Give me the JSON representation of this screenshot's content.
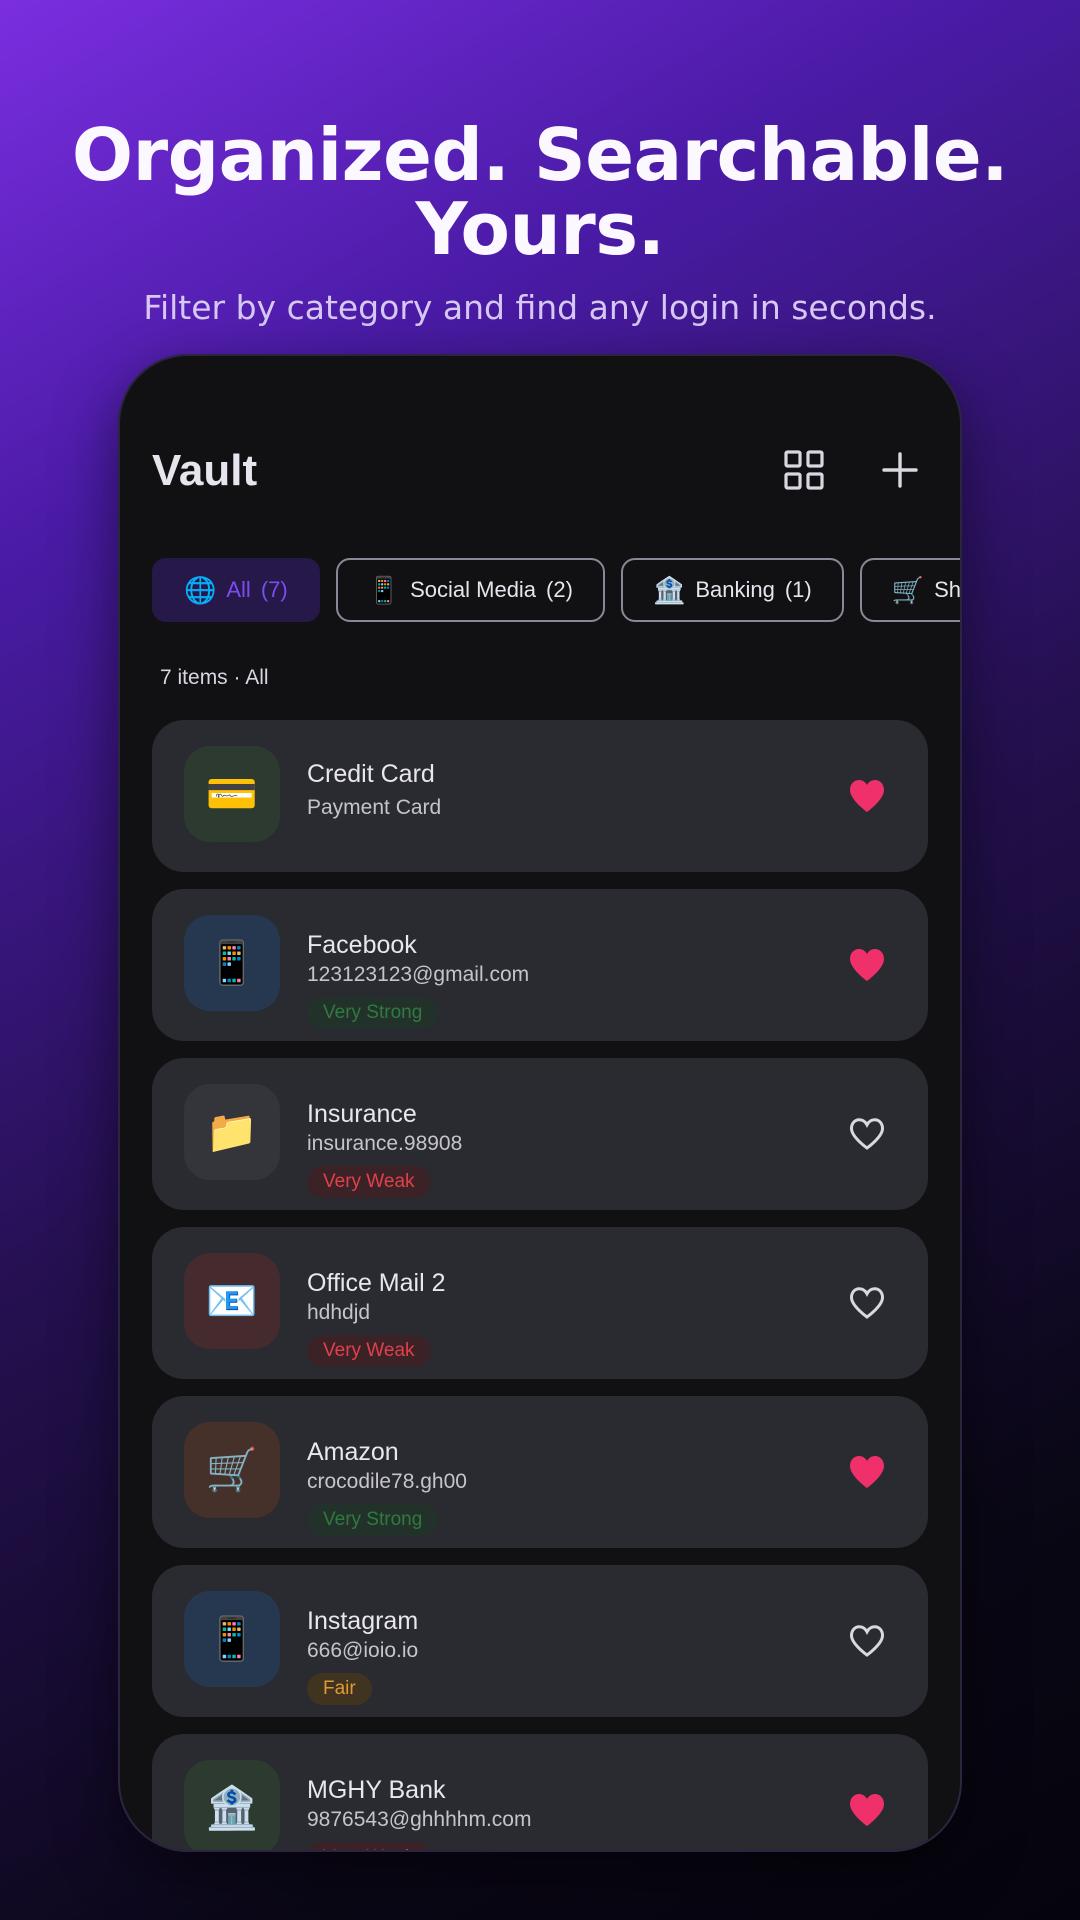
{
  "hero": {
    "title_line1": "Organized. Searchable.",
    "title_line2": "Yours.",
    "subtitle": "Filter by category and find any login in seconds."
  },
  "app": {
    "title": "Vault",
    "grid_icon": "grid-view-icon",
    "add_icon": "plus-icon"
  },
  "chips": [
    {
      "emoji": "🌐",
      "label": "All",
      "count": "(7)",
      "active": true
    },
    {
      "emoji": "📱",
      "label": "Social Media",
      "count": "(2)",
      "active": false
    },
    {
      "emoji": "🏦",
      "label": "Banking",
      "count": "(1)",
      "active": false
    },
    {
      "emoji": "🛒",
      "label": "Shoppi",
      "count": "",
      "active": false
    }
  ],
  "count_line": "7 items · All",
  "colors": {
    "accent": "#7b4cf0",
    "heart_filled": "#f0306a",
    "strong": "#2f7a3e",
    "weak": "#e2404a",
    "fair": "#e19a33"
  },
  "items": [
    {
      "emoji": "💳",
      "avatar_bg": "#2d3a30",
      "title": "Credit Card",
      "subtitle": "Payment Card",
      "strength": "",
      "strength_class": "",
      "favorite": true
    },
    {
      "emoji": "📱",
      "avatar_bg": "#26384f",
      "title": "Facebook",
      "subtitle": "123123123@gmail.com",
      "strength": "Very Strong",
      "strength_class": "strong",
      "favorite": true
    },
    {
      "emoji": "📁",
      "avatar_bg": "#34343b",
      "title": "Insurance",
      "subtitle": "insurance.98908",
      "strength": "Very Weak",
      "strength_class": "weak",
      "favorite": false
    },
    {
      "emoji": "📧",
      "avatar_bg": "#452a2e",
      "title": "Office Mail 2",
      "subtitle": "hdhdjd",
      "strength": "Very Weak",
      "strength_class": "weak",
      "favorite": false
    },
    {
      "emoji": "🛒",
      "avatar_bg": "#45302a",
      "title": "Amazon",
      "subtitle": "crocodile78.gh00",
      "strength": "Very Strong",
      "strength_class": "strong",
      "favorite": true
    },
    {
      "emoji": "📱",
      "avatar_bg": "#26384f",
      "title": "Instagram",
      "subtitle": "666@ioio.io",
      "strength": "Fair",
      "strength_class": "fair",
      "favorite": false
    },
    {
      "emoji": "🏦",
      "avatar_bg": "#2d3a30",
      "title": "MGHY Bank",
      "subtitle": "9876543@ghhhhm.com",
      "strength": "Very Weak",
      "strength_class": "weak",
      "favorite": true
    }
  ]
}
